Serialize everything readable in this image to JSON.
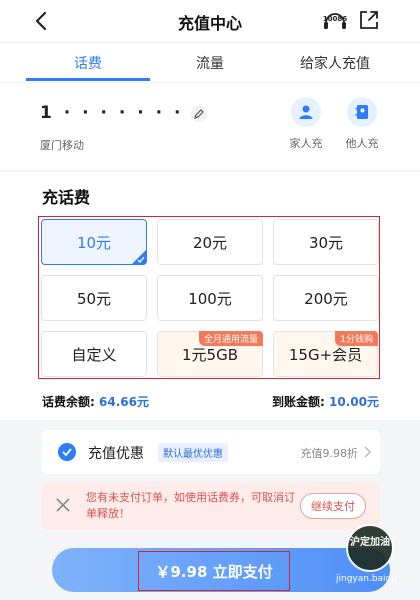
{
  "header": {
    "title": "充值中心",
    "service_icon_text": "10086"
  },
  "tabs": [
    {
      "label": "话费",
      "active": true
    },
    {
      "label": "流量",
      "active": false
    },
    {
      "label": "给家人充值",
      "active": false
    }
  ],
  "account": {
    "phone_masked": "1  ·  ·  ·  ·  ·  ·  ·",
    "carrier": "厦门移动",
    "quick_actions": [
      {
        "label": "家人充",
        "icon": "family-icon"
      },
      {
        "label": "他人充",
        "icon": "contact-book-icon"
      }
    ]
  },
  "recharge": {
    "section_title": "充话费",
    "options": [
      {
        "label": "10元",
        "selected": true
      },
      {
        "label": "20元"
      },
      {
        "label": "30元"
      },
      {
        "label": "50元"
      },
      {
        "label": "100元"
      },
      {
        "label": "200元"
      },
      {
        "label": "自定义"
      },
      {
        "label": "1元5GB",
        "tag": "全月通用流量"
      },
      {
        "label": "15G+会员",
        "tag": "1分钱购"
      }
    ],
    "balance_label": "话费余额:",
    "balance_value": "64.66元",
    "arrival_label": "到账金额:",
    "arrival_value": "10.00元"
  },
  "discount": {
    "label": "充值优惠",
    "badge": "默认最优优惠",
    "rate": "充值9.98折"
  },
  "notice": {
    "text": "您有未支付订单，如使用话费券，可取消订单释放！",
    "button": "继续支付"
  },
  "pay": {
    "label": "￥9.98 立即支付"
  },
  "watermark": {
    "badge": "沪定加油",
    "text": "jingyan.baidu"
  },
  "colors": {
    "accent": "#2e7cf6",
    "highlight_frame": "#d8242a",
    "warning": "#d9534f"
  }
}
